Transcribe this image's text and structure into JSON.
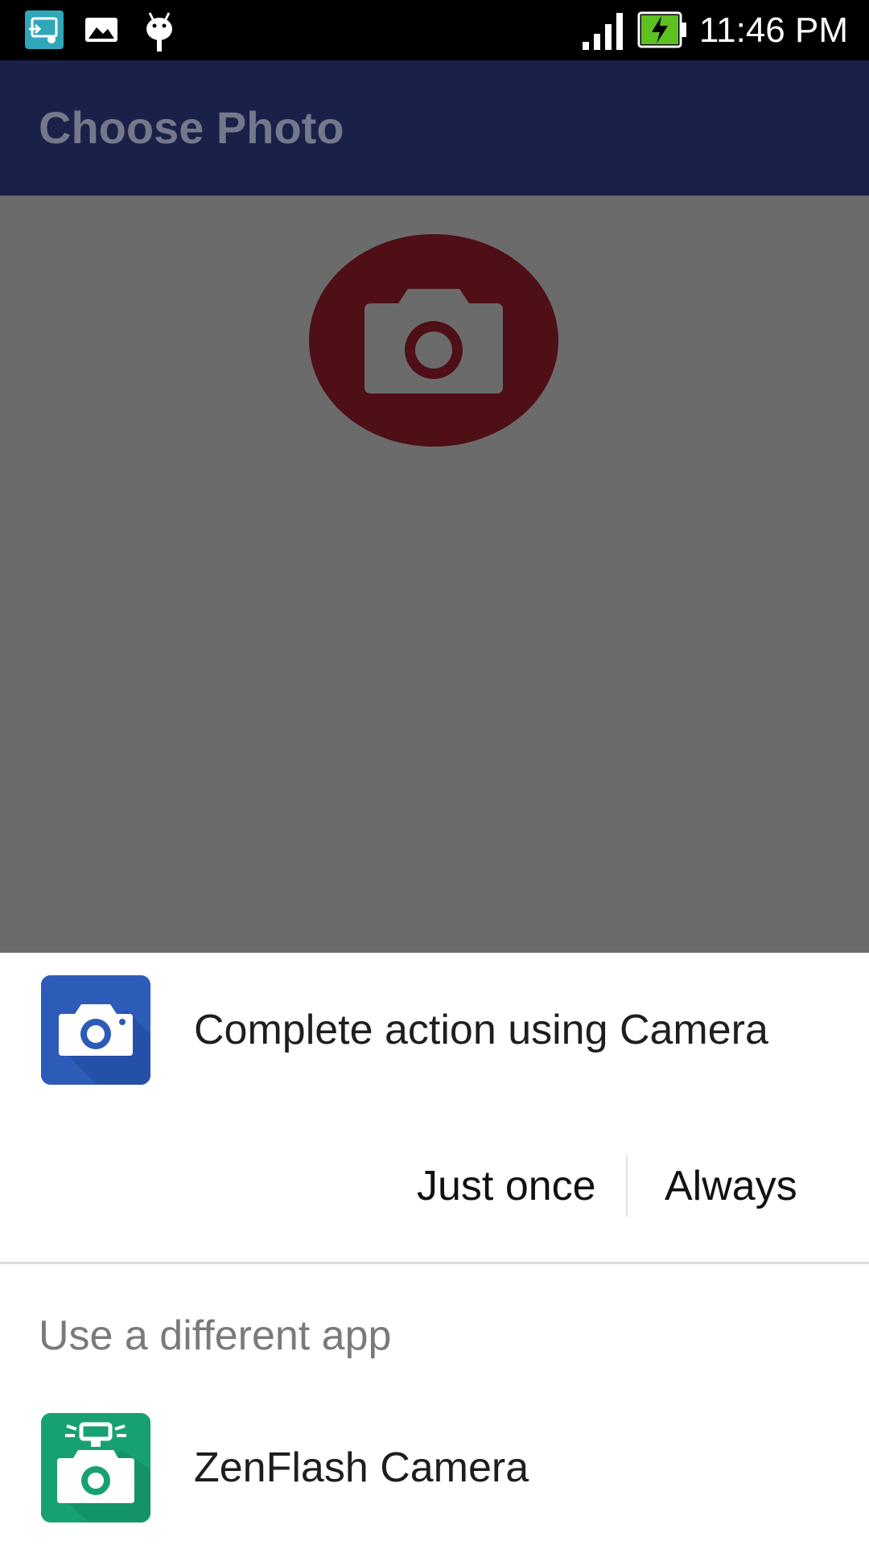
{
  "status_bar": {
    "time": "11:46 PM",
    "icons": [
      "screen-cast-icon",
      "image-icon",
      "android-debug-icon",
      "signal-icon",
      "battery-charging-icon"
    ]
  },
  "app_bar": {
    "title": "Choose Photo"
  },
  "content": {
    "photo_button_icon": "camera-icon",
    "photo_button_color": "#4f0f17"
  },
  "dialog": {
    "title": "Complete action using Camera",
    "default_app_icon": "camera-app-icon",
    "buttons": {
      "just_once": "Just once",
      "always": "Always"
    },
    "other_apps_label": "Use a different app",
    "other_apps": [
      {
        "name": "ZenFlash Camera",
        "icon": "zenflash-camera-icon"
      }
    ]
  },
  "colors": {
    "status_bar": "#000000",
    "app_bar": "#1a2149",
    "scrim_background": "#6b6b6b",
    "sheet_background": "#ffffff",
    "camera_app_blue": "#2c5bb8",
    "zenflash_green": "#17a173"
  }
}
